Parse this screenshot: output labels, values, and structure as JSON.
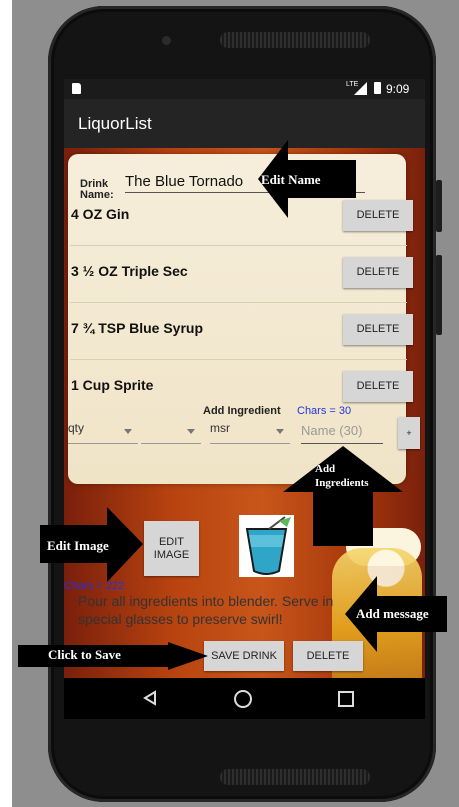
{
  "app": {
    "title": "LiquorList"
  },
  "status_bar": {
    "time": "9:09",
    "network": "LTE"
  },
  "drink": {
    "name_label": "Drink Name:",
    "name_value": "The Blue Tornado"
  },
  "ingredients": [
    {
      "text": "4 OZ Gin",
      "delete_label": "DELETE"
    },
    {
      "text": "3 ½ OZ Triple Sec",
      "delete_label": "DELETE"
    },
    {
      "text": "7 ¾ TSP Blue Syrup",
      "delete_label": "DELETE"
    },
    {
      "text": "1 Cup Sprite",
      "delete_label": "DELETE"
    }
  ],
  "add_ingredient": {
    "label": "Add Ingredient",
    "chars_label": "Chars = 30",
    "qty_value": "qty",
    "fraction_value": "",
    "measure_value": "msr",
    "name_placeholder": "Name (30)",
    "add_button_label": "+"
  },
  "image_section": {
    "edit_button_label": "EDIT IMAGE"
  },
  "message": {
    "chars_label": "Chars = 222",
    "text": "Pour all ingredients into blender. Serve in special glasses to preserve swirl!"
  },
  "actions": {
    "save_label": "SAVE DRINK",
    "delete_label": "DELETE"
  },
  "annotations": {
    "edit_name": "Edit Name",
    "add_ingredients": "Add Ingredients",
    "edit_image": "Edit Image",
    "add_message": "Add message",
    "click_to_save": "Click to Save"
  },
  "colors": {
    "accent_chars": "#2233dd",
    "content_background": "#c8561a",
    "button_gray": "#d6d6d6"
  }
}
